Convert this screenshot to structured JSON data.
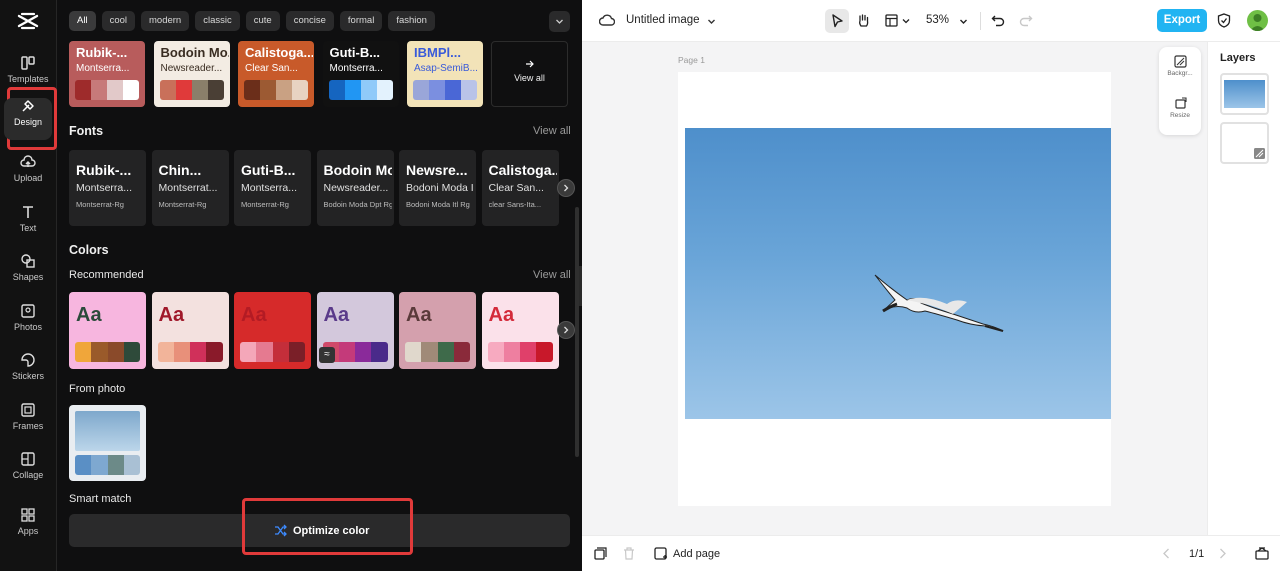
{
  "rail": {
    "items": [
      {
        "label": "Templates",
        "icon": "templates-icon"
      },
      {
        "label": "Design",
        "icon": "design-icon"
      },
      {
        "label": "Upload",
        "icon": "upload-icon"
      },
      {
        "label": "Text",
        "icon": "text-icon"
      },
      {
        "label": "Shapes",
        "icon": "shapes-icon"
      },
      {
        "label": "Photos",
        "icon": "photos-icon"
      },
      {
        "label": "Stickers",
        "icon": "stickers-icon"
      },
      {
        "label": "Frames",
        "icon": "frames-icon"
      },
      {
        "label": "Collage",
        "icon": "collage-icon"
      },
      {
        "label": "Apps",
        "icon": "apps-icon"
      }
    ],
    "active": "Design"
  },
  "filters": [
    "All",
    "cool",
    "modern",
    "classic",
    "cute",
    "concise",
    "formal",
    "fashion"
  ],
  "theme_cards": [
    {
      "title": "Rubik-...",
      "subtitle": "Montserra...",
      "bg": "#b85c5c",
      "fg": "#ffffff",
      "swatches": [
        "#9e2b2b",
        "#c77a7a",
        "#e2c9c9",
        "#ffffff"
      ]
    },
    {
      "title": "Bodoin Mo...",
      "subtitle": "Newsreader...",
      "bg": "#f3ece3",
      "fg": "#3a2d22",
      "swatches": [
        "#c9705a",
        "#e03a3a",
        "#8a7f6a",
        "#4a3f35"
      ]
    },
    {
      "title": "Calistoga...",
      "subtitle": "Clear San...",
      "bg": "#c85a2a",
      "fg": "#ffffff",
      "swatches": [
        "#6b2e1a",
        "#9c5a33",
        "#c9a183",
        "#e8d3c2"
      ]
    },
    {
      "title": "Guti-B...",
      "subtitle": "Montserra...",
      "bg": "#111111",
      "fg": "#ffffff",
      "swatches": [
        "#1565c0",
        "#2196f3",
        "#90caf9",
        "#e3f2fd"
      ]
    },
    {
      "title": "IBMPl...",
      "subtitle": "Asap-SemiB...",
      "bg": "#f2e3b8",
      "fg": "#3a5bd9",
      "swatches": [
        "#9aa6d9",
        "#7b8fe0",
        "#4a67d6",
        "#b9c3e8"
      ]
    }
  ],
  "theme_view_all": "View all",
  "fonts": {
    "title": "Fonts",
    "view_all": "View all",
    "cards": [
      {
        "f1": "Rubik-...",
        "f2": "Montserra...",
        "f3": "Montserrat-Rg"
      },
      {
        "f1": "Chin...",
        "f2": "Montserrat...",
        "f3": "Montserrat-Rg"
      },
      {
        "f1": "Guti-B...",
        "f2": "Montserra...",
        "f3": "Montserrat-Rg"
      },
      {
        "f1": "Bodoin Mo...",
        "f2": "Newsreader...",
        "f3": "Bodoin Moda Dpt Rg"
      },
      {
        "f1": "Newsre...",
        "f2": "Bodoni Moda I...",
        "f3": "Bodoni Moda Itl Rg"
      },
      {
        "f1": "Calistoga...",
        "f2": "Clear San...",
        "f3": "clear Sans-Ita..."
      }
    ]
  },
  "colors": {
    "title": "Colors",
    "recommended": "Recommended",
    "view_all": "View all",
    "aa": "Aa",
    "cards": [
      {
        "bg": "#f7b6df",
        "fg": "#2a4a3a",
        "swatches": [
          "#f0a63a",
          "#9a5a2a",
          "#8a4a2a",
          "#2e4a3a"
        ]
      },
      {
        "bg": "#f3e1df",
        "fg": "#a0182a",
        "swatches": [
          "#f2b49a",
          "#e8907a",
          "#d0305a",
          "#8a1a2a"
        ]
      },
      {
        "bg": "#d62a2a",
        "fg": "#b31b24",
        "swatches": [
          "#f4a7b9",
          "#e57a90",
          "#c42e3a",
          "#7a1f28"
        ]
      },
      {
        "bg": "#d3c8dc",
        "fg": "#5a3a8a",
        "swatches": [
          "#d04a6a",
          "#c43a7a",
          "#8a2a9a",
          "#4a2a8a"
        ]
      },
      {
        "bg": "#d4a0ad",
        "fg": "#5a3a3a",
        "swatches": [
          "#e0d8cc",
          "#a08a78",
          "#3e6a4a",
          "#8a2a3a"
        ]
      },
      {
        "bg": "#fbe1ea",
        "fg": "#d42a3a",
        "swatches": [
          "#f7aac0",
          "#ee7fa0",
          "#e0406a",
          "#c8182a"
        ]
      }
    ]
  },
  "from_photo": {
    "title": "From photo",
    "swatches": [
      "#5a8fc5",
      "#7ea8d0",
      "#6c8a88",
      "#a9c0d4"
    ]
  },
  "smart_match": {
    "title": "Smart match",
    "button": "Optimize color"
  },
  "topbar": {
    "title": "Untitled image",
    "zoom": "53%",
    "export": "Export"
  },
  "canvas": {
    "page_label": "Page 1",
    "side_tools": [
      "Backgr...",
      "Resize"
    ]
  },
  "layers": {
    "title": "Layers"
  },
  "bottombar": {
    "add_page": "Add page",
    "page_count": "1/1"
  }
}
